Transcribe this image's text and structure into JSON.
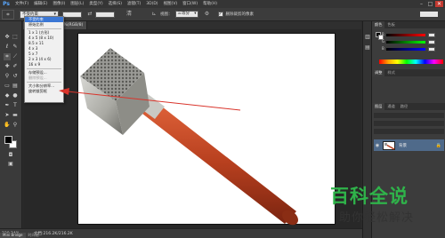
{
  "app": {
    "logo": "Ps",
    "menus": [
      "文件(F)",
      "编辑(E)",
      "图像(I)",
      "图层(L)",
      "类型(Y)",
      "选择(S)",
      "滤镜(T)",
      "3D(D)",
      "视图(V)",
      "窗口(W)",
      "帮助(H)"
    ],
    "window_controls": [
      "–",
      "□",
      "✕"
    ]
  },
  "options_bar": {
    "ratio_value": "不受约束",
    "view_label": "视图：",
    "view_value": "三等分",
    "delete_cropped_label": "删除裁剪的像素",
    "delete_cropped_checked": true
  },
  "document": {
    "tab_label": "476044.jpg @ 230%(RGB/8)"
  },
  "ratio_dropdown": {
    "items_group1": [
      "不受约束",
      "原始比例"
    ],
    "items_group2": [
      "1 x 1 (方形)",
      "4 x 5 (8 x 10)",
      "8.5 x 11",
      "4 x 3",
      "5 x 7",
      "2 x 3 (4 x 6)",
      "16 x 9"
    ],
    "items_group3": [
      "存储预设...",
      "删除预设..."
    ],
    "items_group4": [
      "大小和分辨率...",
      "旋转裁剪框"
    ],
    "selected_index": 0
  },
  "status": {
    "zoom": "230.24%",
    "doc_info": "文档:216.2K/216.2K",
    "mini_bridge_tab": "Mini Bridge",
    "timeline_tab": "时间轴"
  },
  "panels": {
    "color_tabs": [
      "颜色",
      "色板"
    ],
    "color_channels": [
      "R",
      "G",
      "B"
    ],
    "adjust_tabs": [
      "调整",
      "样式"
    ],
    "layers_tabs": [
      "图层",
      "通道",
      "路径"
    ],
    "layer_name": "背景"
  },
  "watermark": {
    "title": "百科全说",
    "subtitle": "助你轻松解决"
  },
  "colors": {
    "accent_green": "#2fb34a",
    "selection_blue": "#3b77d4",
    "arrow_red": "#d9342b"
  }
}
